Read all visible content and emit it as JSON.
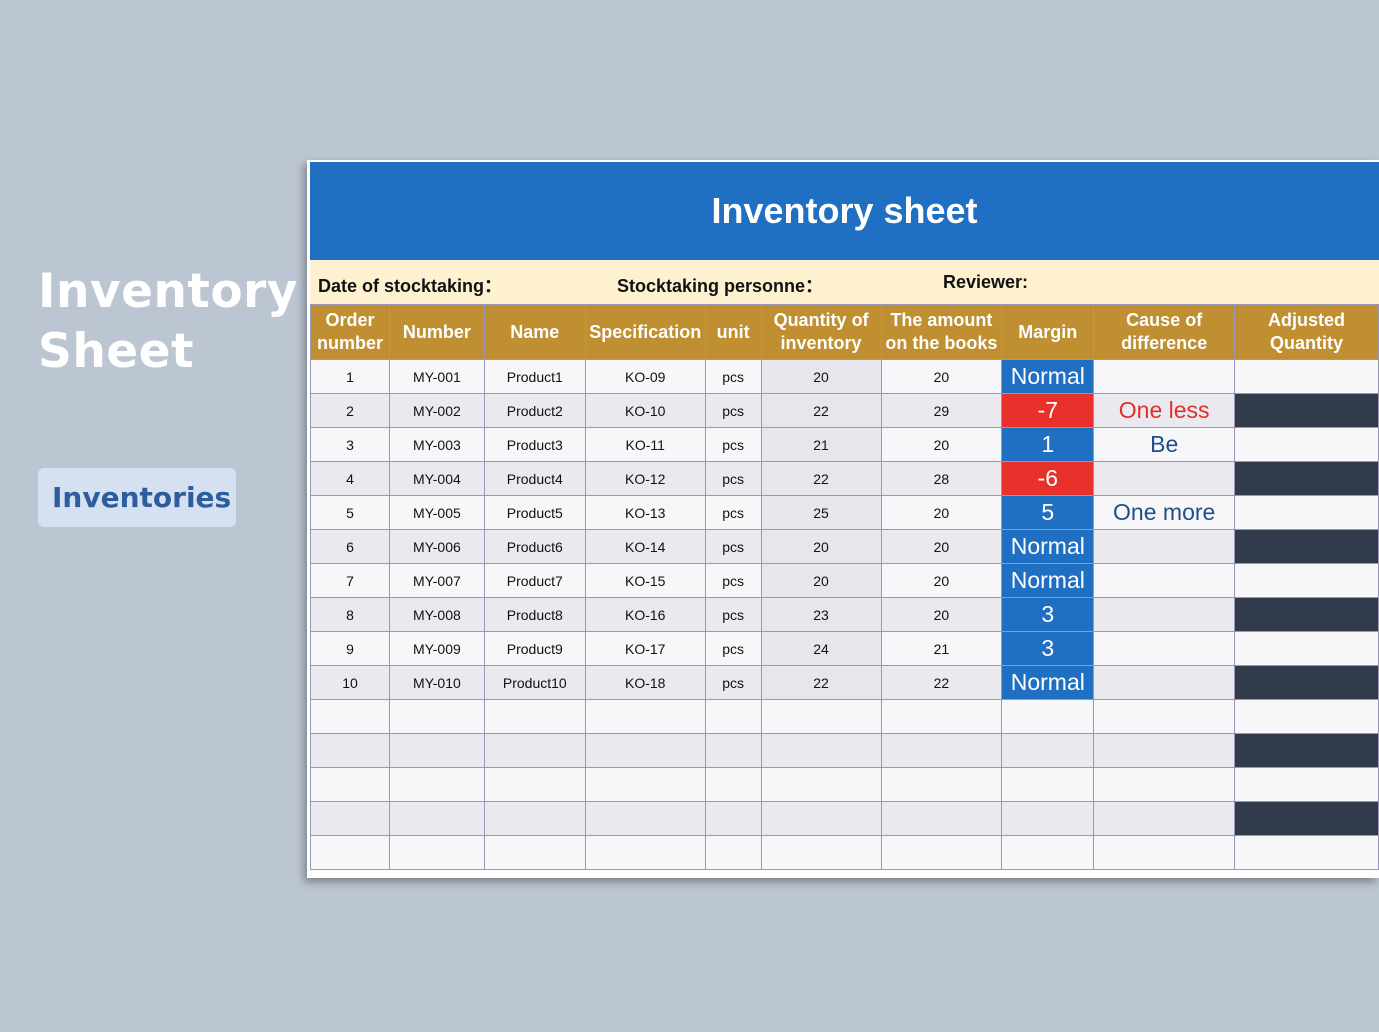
{
  "side": {
    "title_line1": "Inventory",
    "title_line2": "Sheet",
    "button_label": "Inventories"
  },
  "sheet": {
    "title": "Inventory sheet",
    "meta": {
      "date_label": "Date of stocktaking：",
      "personnel_label": "Stocktaking personne：",
      "reviewer_label": "Reviewer:"
    },
    "columns": [
      "Order number",
      "Number",
      "Name",
      "Specification",
      "unit",
      "Quantity of inventory",
      "The amount on the books",
      "Margin",
      "Cause of difference",
      "Adjusted Quantity"
    ],
    "rows": [
      {
        "order": "1",
        "number": "MY-001",
        "name": "Product1",
        "spec": "KO-09",
        "unit": "pcs",
        "qty": "20",
        "books": "20",
        "margin": "Normal",
        "cause": ""
      },
      {
        "order": "2",
        "number": "MY-002",
        "name": "Product2",
        "spec": "KO-10",
        "unit": "pcs",
        "qty": "22",
        "books": "29",
        "margin": "-7",
        "cause": "One less"
      },
      {
        "order": "3",
        "number": "MY-003",
        "name": "Product3",
        "spec": "KO-11",
        "unit": "pcs",
        "qty": "21",
        "books": "20",
        "margin": "1",
        "cause": "Be"
      },
      {
        "order": "4",
        "number": "MY-004",
        "name": "Product4",
        "spec": "KO-12",
        "unit": "pcs",
        "qty": "22",
        "books": "28",
        "margin": "-6",
        "cause": ""
      },
      {
        "order": "5",
        "number": "MY-005",
        "name": "Product5",
        "spec": "KO-13",
        "unit": "pcs",
        "qty": "25",
        "books": "20",
        "margin": "5",
        "cause": "One more"
      },
      {
        "order": "6",
        "number": "MY-006",
        "name": "Product6",
        "spec": "KO-14",
        "unit": "pcs",
        "qty": "20",
        "books": "20",
        "margin": "Normal",
        "cause": ""
      },
      {
        "order": "7",
        "number": "MY-007",
        "name": "Product7",
        "spec": "KO-15",
        "unit": "pcs",
        "qty": "20",
        "books": "20",
        "margin": "Normal",
        "cause": ""
      },
      {
        "order": "8",
        "number": "MY-008",
        "name": "Product8",
        "spec": "KO-16",
        "unit": "pcs",
        "qty": "23",
        "books": "20",
        "margin": "3",
        "cause": ""
      },
      {
        "order": "9",
        "number": "MY-009",
        "name": "Product9",
        "spec": "KO-17",
        "unit": "pcs",
        "qty": "24",
        "books": "21",
        "margin": "3",
        "cause": ""
      },
      {
        "order": "10",
        "number": "MY-010",
        "name": "Product10",
        "spec": "KO-18",
        "unit": "pcs",
        "qty": "22",
        "books": "22",
        "margin": "Normal",
        "cause": ""
      }
    ],
    "empty_rows": 5
  },
  "colors": {
    "background": "#bcc6d3",
    "title_bar": "#1f6fc3",
    "meta_bar": "#fdf1cf",
    "header_gold": "#bf8f32",
    "margin_positive": "#1f6fc3",
    "margin_negative": "#e8312b",
    "adjusted_dark": "#323b4c",
    "button_bg": "#d5e1f1",
    "button_text": "#2d5d9f"
  }
}
